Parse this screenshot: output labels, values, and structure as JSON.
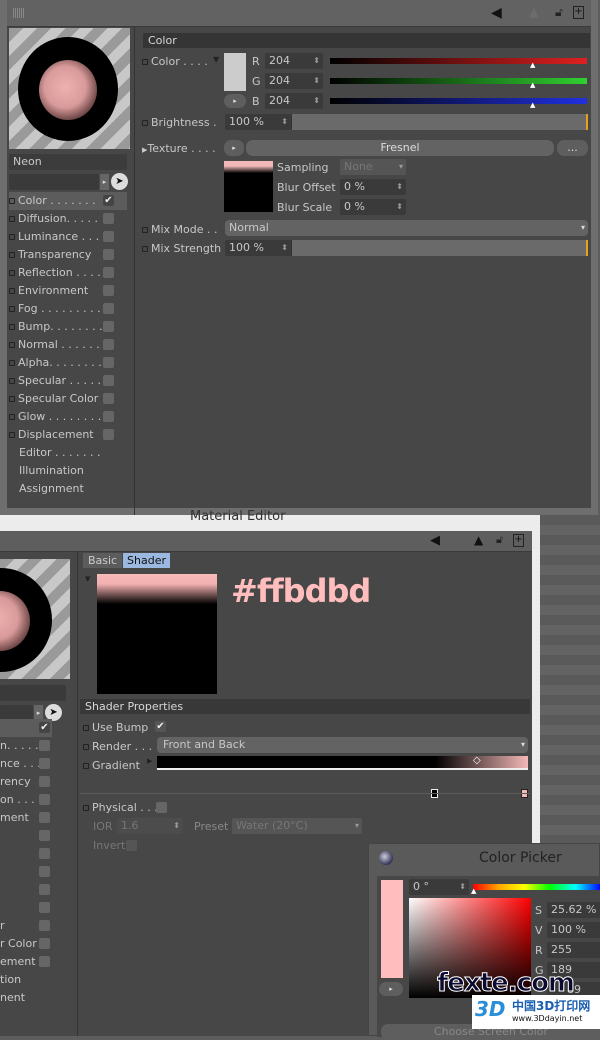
{
  "top_editor": {
    "material_name": "Neon",
    "channels": [
      {
        "label": "Color . . . . . . .",
        "checked": true
      },
      {
        "label": "Diffusion. . . . .",
        "checked": false
      },
      {
        "label": "Luminance . . .",
        "checked": false
      },
      {
        "label": "Transparency",
        "checked": false
      },
      {
        "label": "Reflection . . . .",
        "checked": false
      },
      {
        "label": "Environment",
        "checked": false
      },
      {
        "label": "Fog . . . . . . . . .",
        "checked": false
      },
      {
        "label": "Bump. . . . . . . .",
        "checked": false
      },
      {
        "label": "Normal . . . . . .",
        "checked": false
      },
      {
        "label": "Alpha. . . . . . . .",
        "checked": false
      },
      {
        "label": "Specular . . . . .",
        "checked": false
      },
      {
        "label": "Specular Color",
        "checked": false
      },
      {
        "label": "Glow . . . . . . . .",
        "checked": false
      },
      {
        "label": "Displacement",
        "checked": false
      },
      {
        "label": "Editor . . . . . . .",
        "checked": null
      },
      {
        "label": "Illumination",
        "checked": null
      },
      {
        "label": "Assignment",
        "checked": null
      }
    ],
    "section_title": "Color",
    "color_label": "Color . . . .",
    "r_label": "R",
    "g_label": "G",
    "b_label": "B",
    "r": "204",
    "g": "204",
    "b": "204",
    "color_swatch": "#cccccc",
    "brightness_label": "Brightness .",
    "brightness": "100 %",
    "texture_label": "Texture . . . .",
    "texture_shader": "Fresnel",
    "more_label": "...",
    "sampling_label": "Sampling",
    "sampling": "None",
    "blur_offset_label": "Blur Offset",
    "blur_offset": "0 %",
    "blur_scale_label": "Blur Scale",
    "blur_scale": "0 %",
    "mix_mode_label": "Mix Mode . .",
    "mix_mode": "Normal",
    "mix_strength_label": "Mix Strength",
    "mix_strength": "100 %"
  },
  "bottom_editor": {
    "window_title": "Material Editor",
    "tabs": [
      "Basic",
      "Shader"
    ],
    "active_tab": "Shader",
    "hex_annotation": "#ffbdbd",
    "hex_color": "#ffbdbd",
    "channels_partial": [
      "",
      "n. . . . .",
      "nce . . .",
      "rency",
      "on . . . .",
      "ment",
      "",
      "",
      "",
      "",
      "",
      "r",
      "r Color",
      "ement",
      "tion",
      "nent"
    ],
    "shader_properties_title": "Shader Properties",
    "use_bump_label": "Use Bump",
    "use_bump": true,
    "render_label": "Render . . .",
    "render": "Front and Back",
    "gradient_label": "Gradient",
    "physical_label": "Physical . . .",
    "ior_label": "IOR",
    "ior": "1.6",
    "preset_label": "Preset",
    "preset": "Water (20°C)",
    "invert_label": "Invert"
  },
  "color_picker": {
    "title": "Color Picker",
    "hue": "0 °",
    "s_label": "S",
    "s": "25.62 %",
    "v_label": "V",
    "v": "100 %",
    "r_label": "R",
    "r": "255",
    "g_label": "G",
    "g": "189",
    "b_partial": "89",
    "button_partial": "Choose Screen Color",
    "swatch": "#ffbdbd"
  },
  "watermark": {
    "text1": "fexte.com",
    "text2": "中国3D打印网",
    "text3": "www.3Ddayin.net"
  }
}
